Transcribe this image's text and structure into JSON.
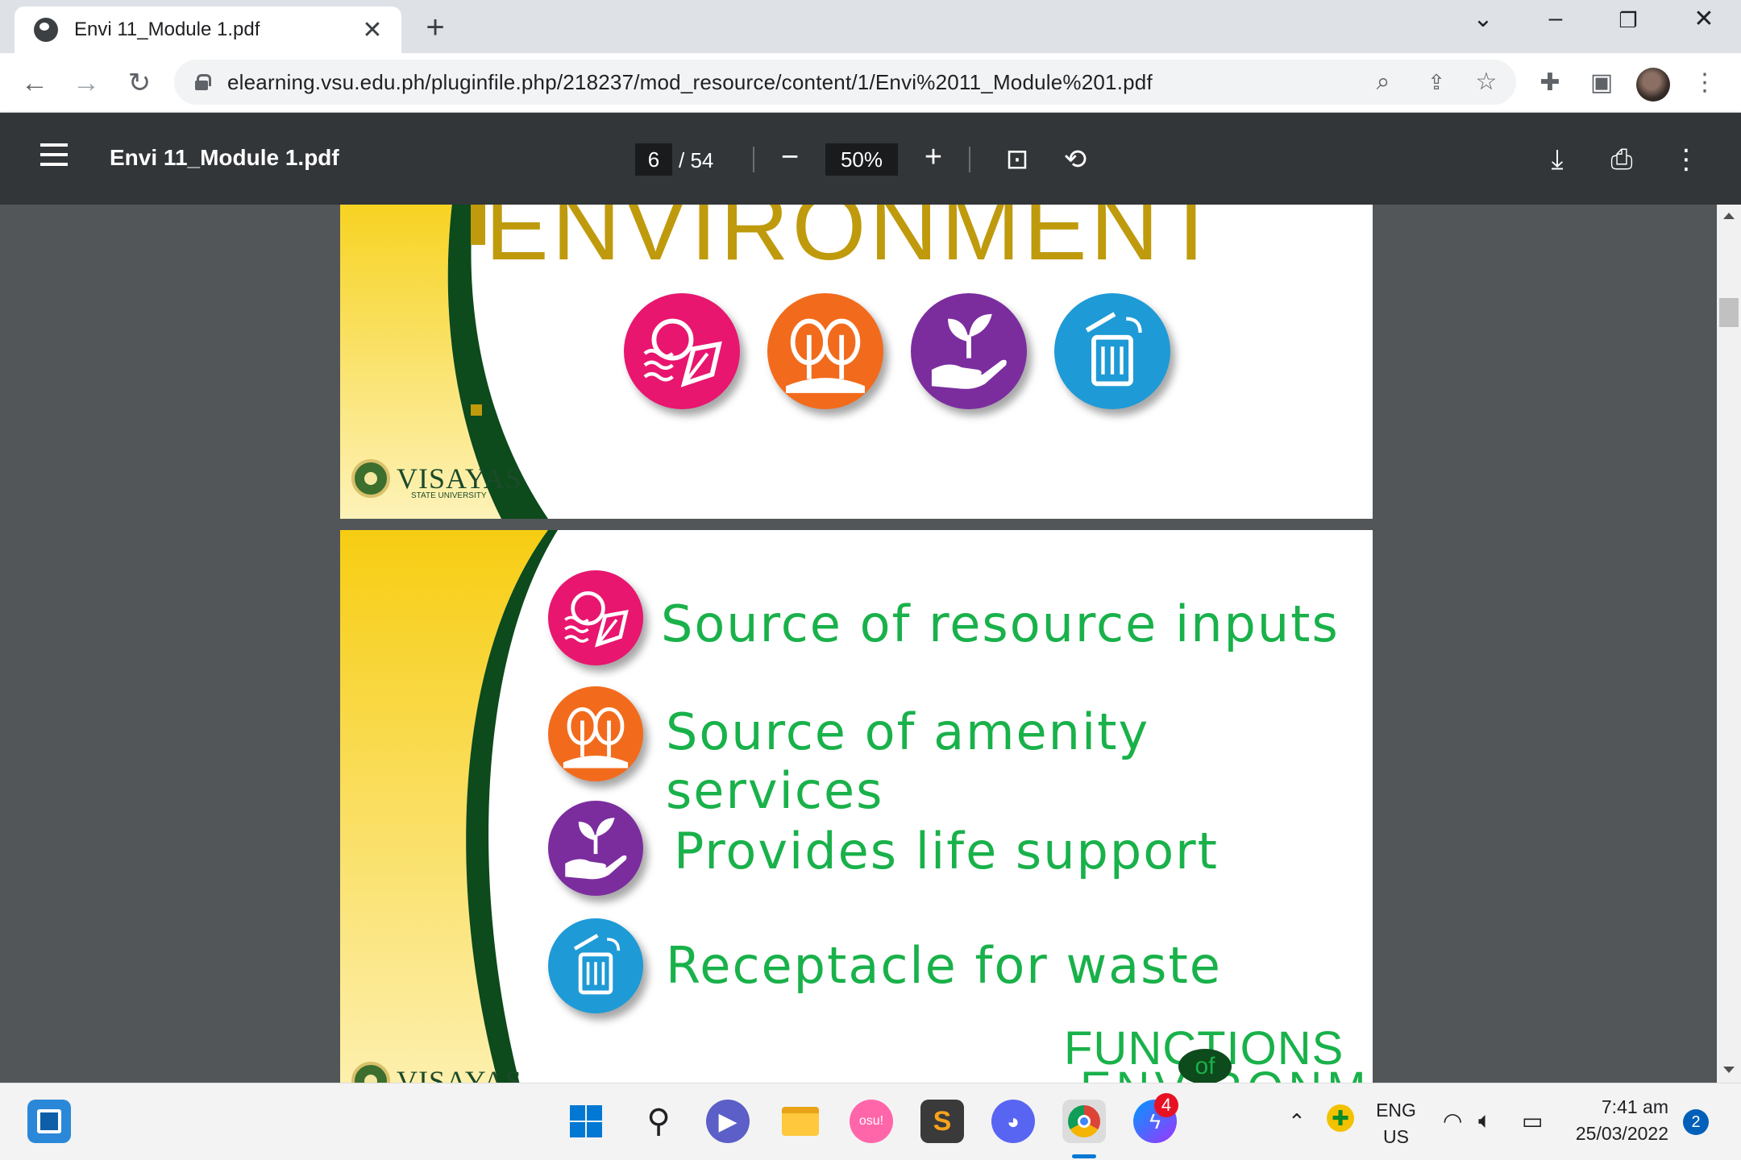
{
  "browser": {
    "tab_title": "Envi 11_Module 1.pdf",
    "url": "elearning.vsu.edu.ph/pluginfile.php/218237/mod_resource/content/1/Envi%2011_Module%201.pdf"
  },
  "pdf_toolbar": {
    "title": "Envi 11_Module 1.pdf",
    "current_page": "6",
    "page_separator": "/ 54",
    "zoom": "50%"
  },
  "slide1": {
    "heading": "ENVIRONMENT",
    "logo_text": "VISAYAS",
    "logo_sub": "STATE UNIVERSITY",
    "icons": [
      "sun-water-leaf-icon",
      "trees-icon",
      "hand-plant-icon",
      "trash-bin-icon"
    ]
  },
  "slide2": {
    "functions": [
      {
        "label": "Source of resource inputs",
        "icon": "sun-water-leaf-icon",
        "color": "#e8166f"
      },
      {
        "label": "Source of amenity services",
        "icon": "trees-icon",
        "color": "#f26b1d"
      },
      {
        "label": "Provides life support",
        "icon": "hand-plant-icon",
        "color": "#7b2d9e"
      },
      {
        "label": "Receptacle for waste",
        "icon": "trash-bin-icon",
        "color": "#1e9ad6"
      }
    ],
    "footer_title": "FUNCTIONS",
    "footer_of": "of",
    "footer_env": "ENVIRONMENT",
    "logo_text": "VISAYAS"
  },
  "taskbar": {
    "lang_top": "ENG",
    "lang_bottom": "US",
    "time": "7:41 am",
    "date": "25/03/2022",
    "notifications": "2",
    "messenger_badge": "4",
    "osu_label": "osu!"
  },
  "colors": {
    "text_green": "#19b14a",
    "title_gold": "#bf9a0c",
    "dark_green": "#0d4a1c",
    "yellow": "#f7d21e"
  }
}
